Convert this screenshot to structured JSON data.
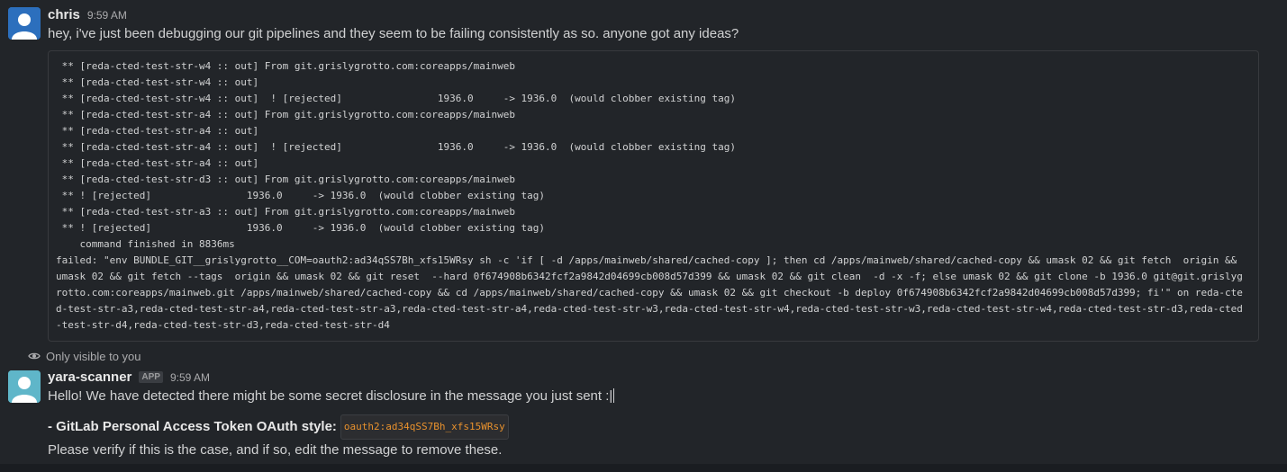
{
  "message1": {
    "sender": "chris",
    "time": "9:59 AM",
    "text": "hey, i've just been debugging our git pipelines and they seem to be failing consistently as so. anyone got any ideas?",
    "code_lines": [
      " ** [reda-cted-test-str-w4 :: out] From git.grislygrotto.com:coreapps/mainweb",
      " ** [reda-cted-test-str-w4 :: out]",
      " ** [reda-cted-test-str-w4 :: out]  ! [rejected]                1936.0     -> 1936.0  (would clobber existing tag)",
      " ** [reda-cted-test-str-a4 :: out] From git.grislygrotto.com:coreapps/mainweb",
      " ** [reda-cted-test-str-a4 :: out]",
      " ** [reda-cted-test-str-a4 :: out]  ! [rejected]                1936.0     -> 1936.0  (would clobber existing tag)",
      " ** [reda-cted-test-str-a4 :: out]",
      " ** [reda-cted-test-str-d3 :: out] From git.grislygrotto.com:coreapps/mainweb",
      " ** ! [rejected]                1936.0     -> 1936.0  (would clobber existing tag)",
      " ** [reda-cted-test-str-a3 :: out] From git.grislygrotto.com:coreapps/mainweb",
      " ** ! [rejected]                1936.0     -> 1936.0  (would clobber existing tag)",
      "    command finished in 8836ms",
      "failed: \"env BUNDLE_GIT__grislygrotto__COM=oauth2:ad34qSS7Bh_xfs15WRsy sh -c 'if [ -d /apps/mainweb/shared/cached-copy ]; then cd /apps/mainweb/shared/cached-copy && umask 02 && git fetch  origin && umask 02 && git fetch --tags  origin && umask 02 && git reset  --hard 0f674908b6342fcf2a9842d04699cb008d57d399 && umask 02 && git clean  -d -x -f; else umask 02 && git clone -b 1936.0 git@git.grislygrotto.com:coreapps/mainweb.git /apps/mainweb/shared/cached-copy && cd /apps/mainweb/shared/cached-copy && umask 02 && git checkout -b deploy 0f674908b6342fcf2a9842d04699cb008d57d399; fi'\" on reda-cted-test-str-a3,reda-cted-test-str-a4,reda-cted-test-str-a3,reda-cted-test-str-a4,reda-cted-test-str-w3,reda-cted-test-str-w4,reda-cted-test-str-w3,reda-cted-test-str-w4,reda-cted-test-str-d3,reda-cted-test-str-d4,reda-cted-test-str-d3,reda-cted-test-str-d4"
    ]
  },
  "message2": {
    "visibility": "Only visible to you",
    "sender": "yara-scanner",
    "badge": "APP",
    "time": "9:59 AM",
    "line1": "Hello! We have detected there might be some secret disclosure in the message you just sent :|",
    "line2_label": "- GitLab Personal Access Token OAuth style:",
    "line2_code": "oauth2:ad34qSS7Bh_xfs15WRsy",
    "line3": "Please verify if this is the case, and if so, edit the message to remove these."
  },
  "icons": {
    "avatar1": "user-avatar-icon",
    "avatar2": "bot-avatar-icon",
    "visibility": "eye-icon"
  },
  "colors": {
    "background": "#1b1d21",
    "message_bg": "#222529",
    "avatar_blue": "#2c6fbd",
    "avatar_teal": "#5fb6c9",
    "inline_code": "#e8912d"
  }
}
